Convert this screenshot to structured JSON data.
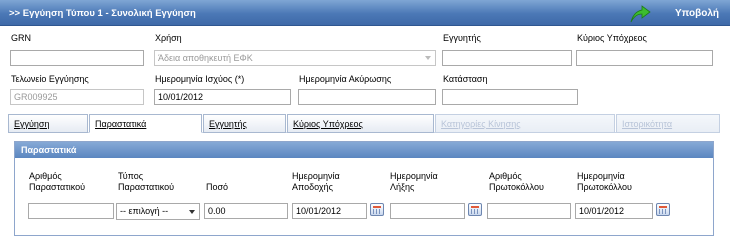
{
  "header": {
    "title": ">> Εγγύηση Τύπου 1 - Συνολική Εγγύηση",
    "submit_label": "Υποβολή"
  },
  "form": {
    "grn_label": "GRN",
    "grn_value": "",
    "use_label": "Χρήση",
    "use_value": "Άδεια αποθηκευτή ΕΦΚ",
    "guarantor_label": "Εγγυητής",
    "guarantor_value": "",
    "principal_label": "Κύριος Υπόχρεος",
    "principal_value": "",
    "customs_label": "Τελωνείο Εγγύησης",
    "customs_value": "GR009925",
    "valid_date_label": "Ημερομηνία Ισχύος (*)",
    "valid_date_value": "10/01/2012",
    "cancel_date_label": "Ημερομηνία Ακύρωσης",
    "cancel_date_value": "",
    "status_label": "Κατάσταση",
    "status_value": ""
  },
  "tabs": [
    {
      "label": "Εγγύηση"
    },
    {
      "label": "Παραστατικά"
    },
    {
      "label": "Εγγυητής"
    },
    {
      "label": "Κύριος Υπόχρεος"
    },
    {
      "label": "Κατηγορίες Κίνησης"
    },
    {
      "label": "Ιστορικότητα"
    }
  ],
  "panel": {
    "title": "Παραστατικά",
    "col_doc_number_1": "Αριθμός",
    "col_doc_number_2": "Παραστατικού",
    "col_doc_type_1": "Τύπος",
    "col_doc_type_2": "Παραστατικού",
    "col_amount": "Ποσό",
    "col_accept_date_1": "Ημερομηνία",
    "col_accept_date_2": "Αποδοχής",
    "col_expiry_date_1": "Ημερομηνία",
    "col_expiry_date_2": "Λήξης",
    "col_protocol_number_1": "Αριθμός",
    "col_protocol_number_2": "Πρωτοκόλλου",
    "col_protocol_date_1": "Ημερομηνία",
    "col_protocol_date_2": "Πρωτοκόλλου",
    "doc_number_value": "",
    "doc_type_value": "-- επιλογή --",
    "amount_value": "0.00",
    "accept_date_value": "10/01/2012",
    "expiry_date_value": "",
    "protocol_number_value": "",
    "protocol_date_value": "10/01/2012"
  },
  "colors": {
    "title_bar": "#4b78b6",
    "panel_header": "#5b86c0",
    "submit_arrow": "#3cbd2e"
  },
  "icons": [
    "green-arrow-icon",
    "calendar-icon"
  ]
}
